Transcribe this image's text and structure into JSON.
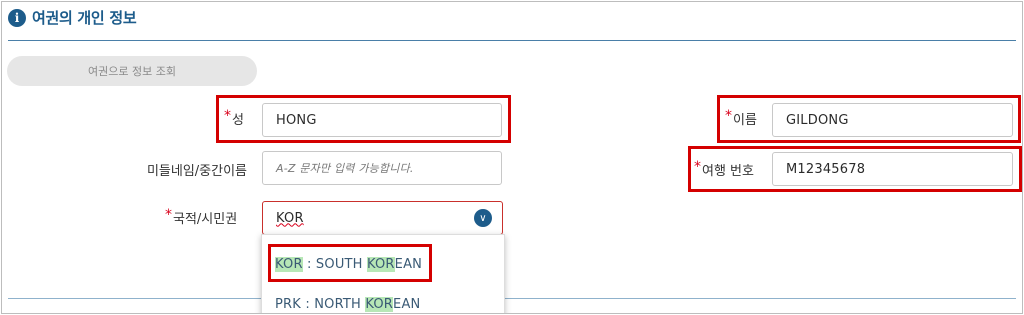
{
  "section": {
    "title": "여권의 개인 정보",
    "info_icon": "i"
  },
  "lookup_button": "여권으로 정보 조회",
  "fields": {
    "surname": {
      "label": "성",
      "value": "HONG"
    },
    "given_name": {
      "label": "이름",
      "value": "GILDONG"
    },
    "middle_name": {
      "label": "미들네임/중간이름",
      "placeholder": "A-Z 문자만 입력 가능합니다."
    },
    "passport_no": {
      "label": "여행 번호",
      "value": "M12345678"
    },
    "nationality": {
      "label": "국적/시민권",
      "value": "KOR"
    }
  },
  "required_mark": "*",
  "dropdown": {
    "options": [
      {
        "code": "KOR",
        "sep": " : SOUTH ",
        "match": "KOR",
        "rest": "EAN"
      },
      {
        "code": "PRK",
        "sep": " : NORTH ",
        "match": "KOR",
        "rest": "EAN"
      }
    ]
  },
  "colors": {
    "accent": "#1d5c8b",
    "required": "#d9001b",
    "annotation_box": "#d40000",
    "match_highlight": "#b7e7b6"
  }
}
